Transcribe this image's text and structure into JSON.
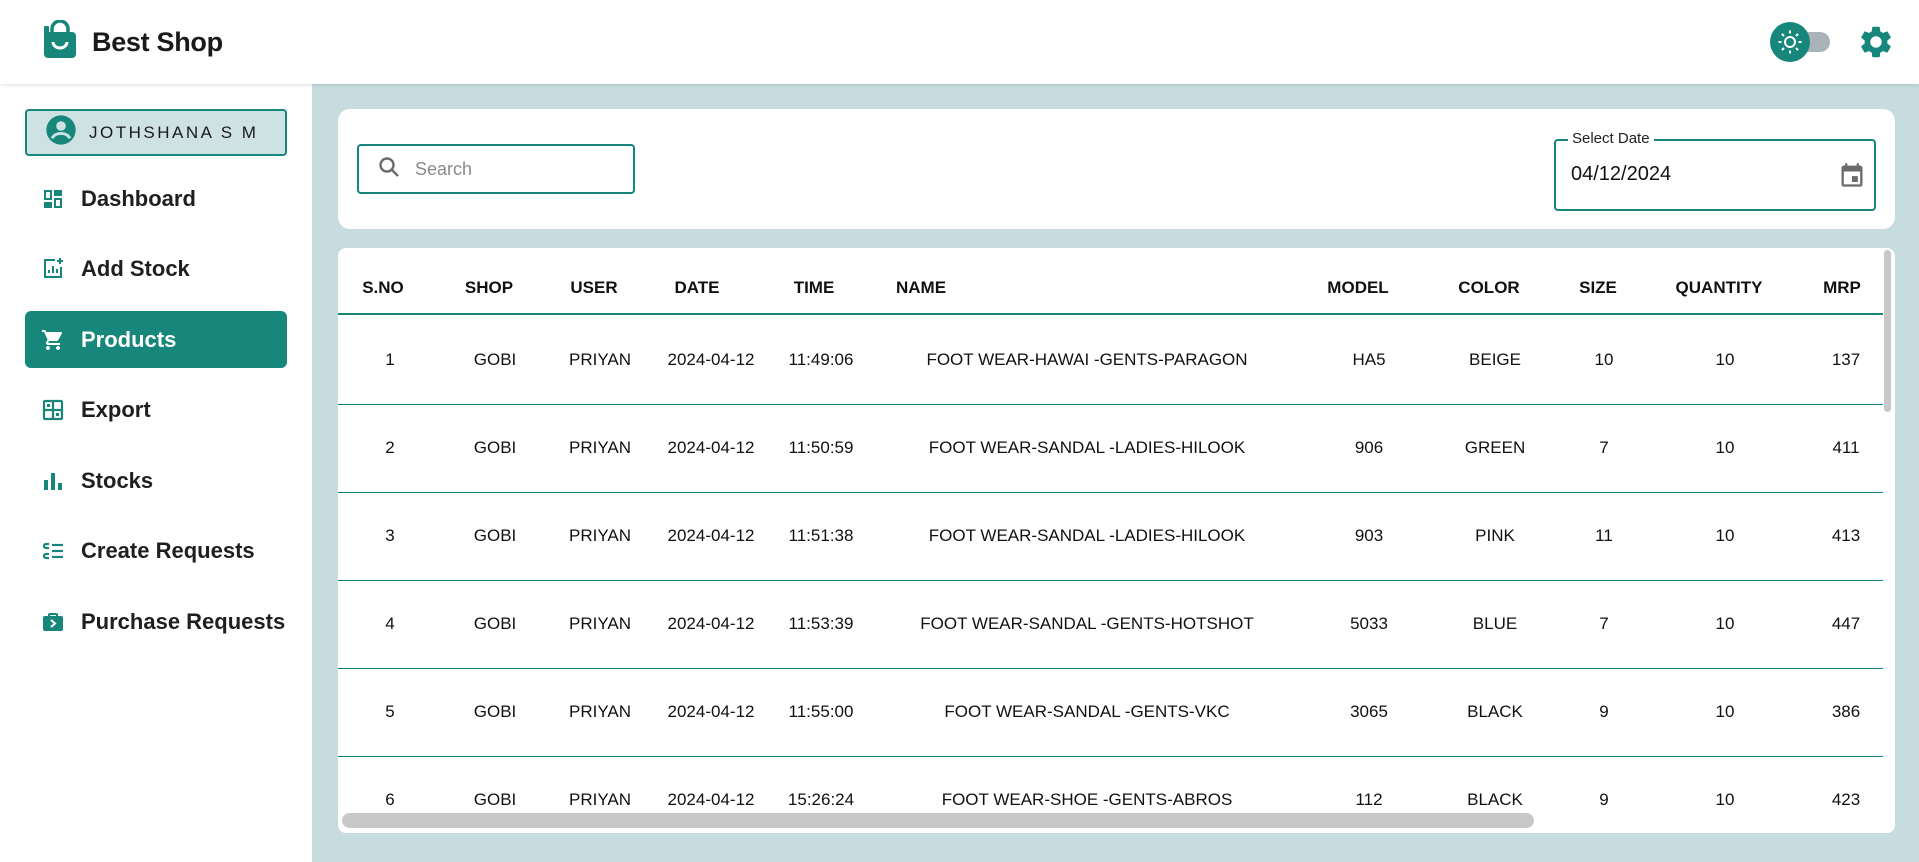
{
  "app": {
    "title": "Best Shop"
  },
  "colors": {
    "accent": "#17877c",
    "accent_light": "#cfe2e3",
    "content_bg": "#c6dcdf"
  },
  "header": {
    "theme_toggle_icon": "sun-icon",
    "settings_icon": "gear-icon"
  },
  "sidebar": {
    "user": {
      "name": "JOTHSHANA S M",
      "icon": "account-circle-icon"
    },
    "items": [
      {
        "label": "Dashboard",
        "icon": "dashboard-icon",
        "active": false
      },
      {
        "label": "Add Stock",
        "icon": "add-chart-icon",
        "active": false
      },
      {
        "label": "Products",
        "icon": "cart-icon",
        "active": true
      },
      {
        "label": "Export",
        "icon": "grid-icon",
        "active": false
      },
      {
        "label": "Stocks",
        "icon": "bar-chart-icon",
        "active": false
      },
      {
        "label": "Create Requests",
        "icon": "list-request-icon",
        "active": false
      },
      {
        "label": "Purchase Requests",
        "icon": "briefcase-arrow-icon",
        "active": false
      }
    ]
  },
  "filters": {
    "search": {
      "placeholder": "Search",
      "value": ""
    },
    "date": {
      "label": "Select Date",
      "value": "04/12/2024"
    }
  },
  "table": {
    "columns": [
      "S.NO",
      "SHOP",
      "USER",
      "DATE",
      "TIME",
      "NAME",
      "MODEL",
      "COLOR",
      "SIZE",
      "QUANTITY",
      "MRP"
    ],
    "rows": [
      [
        "1",
        "GOBI",
        "PRIYAN",
        "2024-04-12",
        "11:49:06",
        "FOOT WEAR-HAWAI -GENTS-PARAGON",
        "HA5",
        "BEIGE",
        "10",
        "10",
        "137"
      ],
      [
        "2",
        "GOBI",
        "PRIYAN",
        "2024-04-12",
        "11:50:59",
        "FOOT WEAR-SANDAL -LADIES-HILOOK",
        "906",
        "GREEN",
        "7",
        "10",
        "411"
      ],
      [
        "3",
        "GOBI",
        "PRIYAN",
        "2024-04-12",
        "11:51:38",
        "FOOT WEAR-SANDAL -LADIES-HILOOK",
        "903",
        "PINK",
        "11",
        "10",
        "413"
      ],
      [
        "4",
        "GOBI",
        "PRIYAN",
        "2024-04-12",
        "11:53:39",
        "FOOT WEAR-SANDAL -GENTS-HOTSHOT",
        "5033",
        "BLUE",
        "7",
        "10",
        "447"
      ],
      [
        "5",
        "GOBI",
        "PRIYAN",
        "2024-04-12",
        "11:55:00",
        "FOOT WEAR-SANDAL -GENTS-VKC",
        "3065",
        "BLACK",
        "9",
        "10",
        "386"
      ],
      [
        "6",
        "GOBI",
        "PRIYAN",
        "2024-04-12",
        "15:26:24",
        "FOOT WEAR-SHOE -GENTS-ABROS",
        "112",
        "BLACK",
        "9",
        "10",
        "423"
      ]
    ]
  }
}
